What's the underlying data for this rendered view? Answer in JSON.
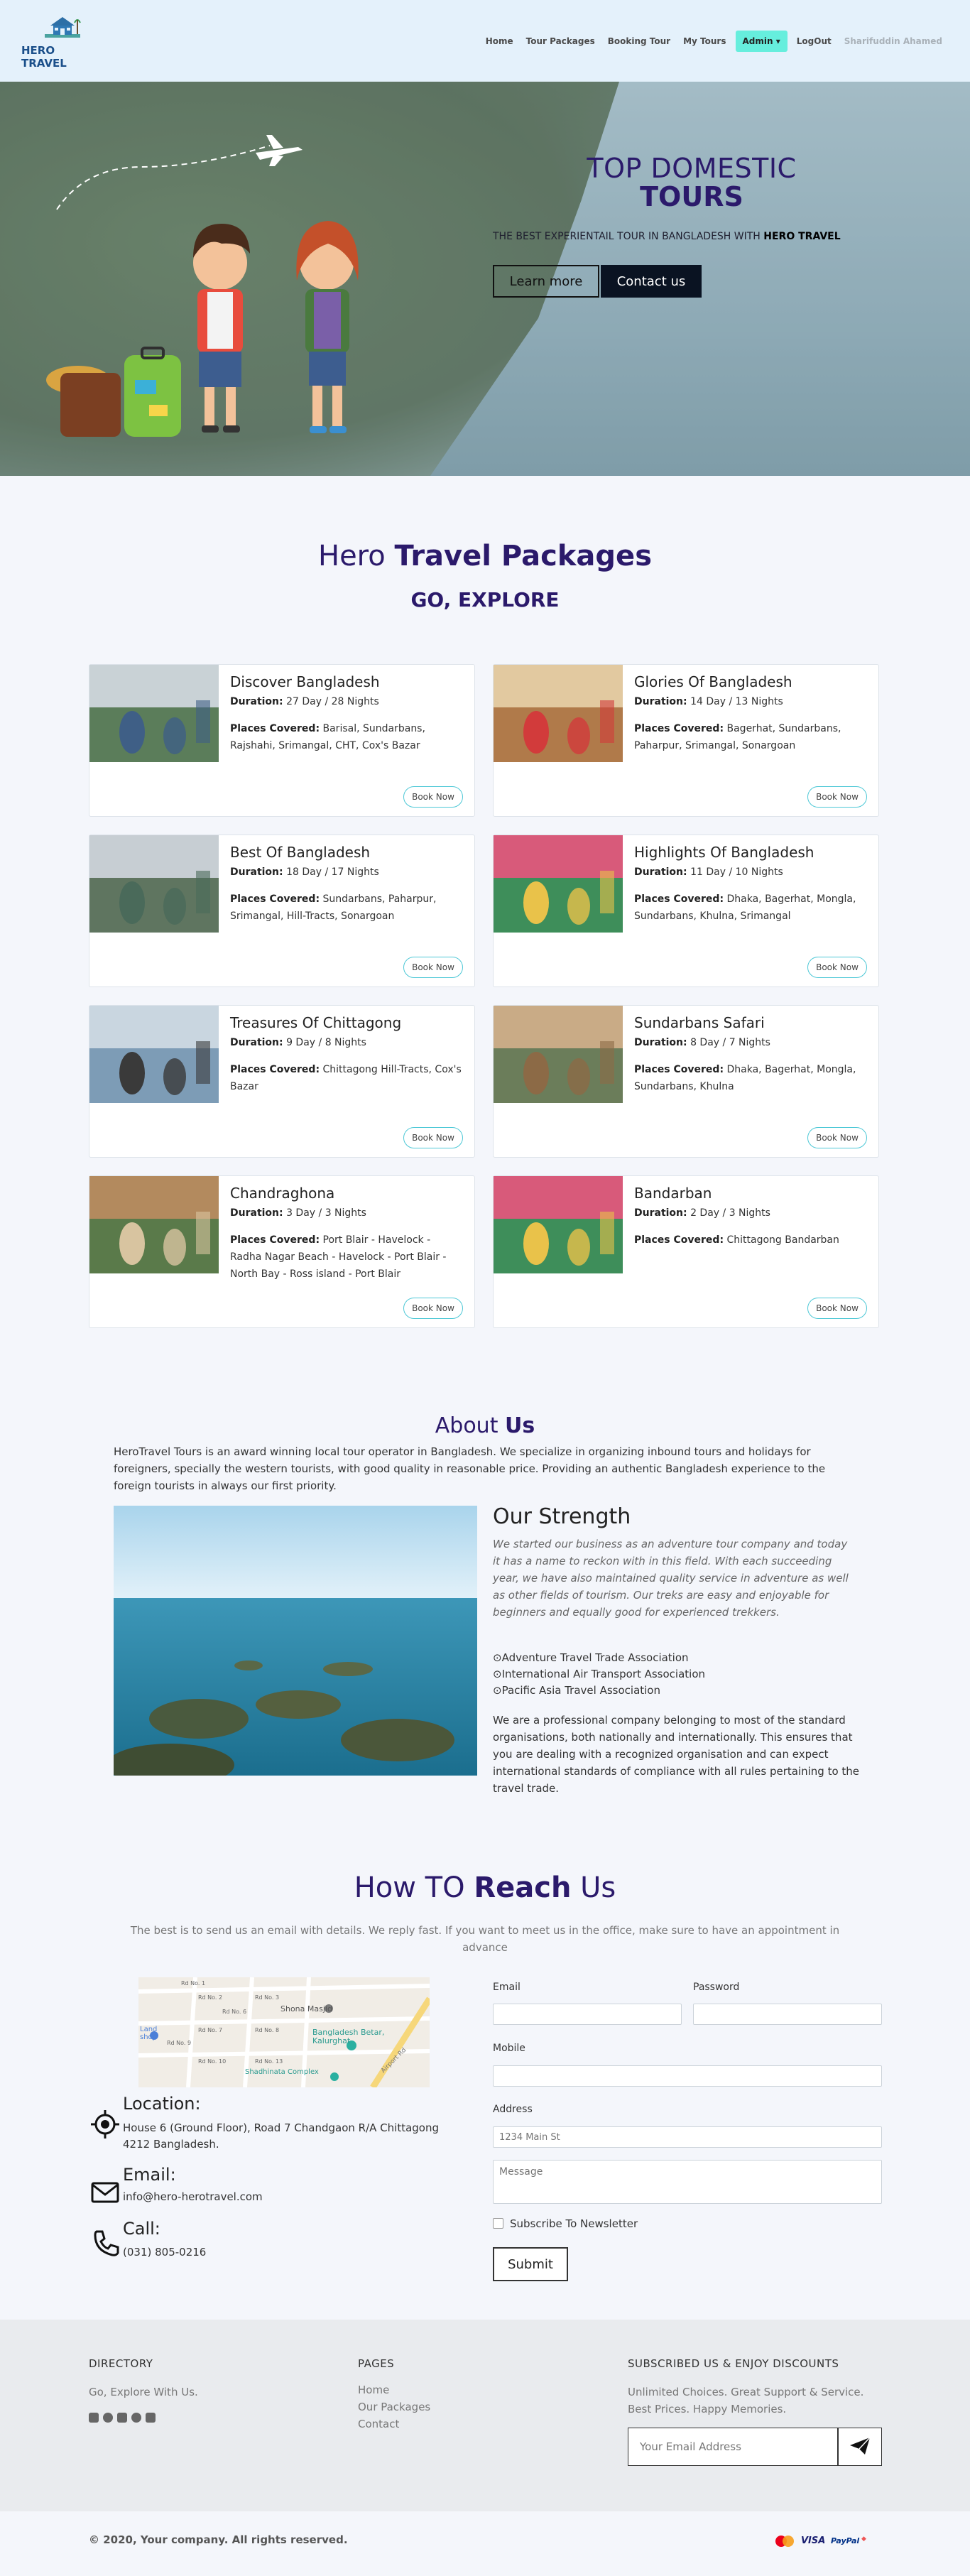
{
  "nav": {
    "brand": "HERO TRAVEL",
    "links": [
      "Home",
      "Tour Packages",
      "Booking Tour",
      "My Tours"
    ],
    "admin": "Admin",
    "logout": "LogOut",
    "user": "Sharifuddin Ahamed"
  },
  "hero": {
    "title_line1": "TOP DOMESTIC",
    "title_line2": "TOURS",
    "subtitle_prefix": "THE BEST EXPERIENTAIL TOUR IN BANGLADESH WITH",
    "subtitle_brand": "HERO TRAVEL",
    "learn_more": "Learn more",
    "contact_us": "Contact us"
  },
  "packages": {
    "title_plain": "Hero",
    "title_bold": "Travel Packages",
    "subtitle": "GO, EXPLORE",
    "duration_label": "Duration:",
    "places_label": "Places Covered:",
    "book_label": "Book Now",
    "items": [
      {
        "title": "Discover Bangladesh",
        "duration": "27 Day / 28 Nights",
        "places": "Barisal, Sundarbans, Rajshahi, Srimangal, CHT, Cox's Bazar"
      },
      {
        "title": "Glories Of Bangladesh",
        "duration": "14 Day / 13 Nights",
        "places": "Bagerhat, Sundarbans, Paharpur, Srimangal, Sonargoan"
      },
      {
        "title": "Best Of Bangladesh",
        "duration": "18 Day / 17 Nights",
        "places": "Sundarbans, Paharpur, Srimangal, Hill-Tracts, Sonargoan"
      },
      {
        "title": "Highlights Of Bangladesh",
        "duration": "11 Day / 10 Nights",
        "places": "Dhaka, Bagerhat, Mongla, Sundarbans, Khulna, Srimangal"
      },
      {
        "title": "Treasures Of Chittagong",
        "duration": "9 Day / 8 Nights",
        "places": "Chittagong Hill-Tracts, Cox's Bazar"
      },
      {
        "title": "Sundarbans Safari",
        "duration": "8 Day / 7 Nights",
        "places": "Dhaka, Bagerhat, Mongla, Sundarbans, Khulna"
      },
      {
        "title": "Chandraghona",
        "duration": "3 Day / 3 Nights",
        "places": "Port Blair - Havelock - Radha Nagar Beach - Havelock - Port Blair - North Bay - Ross island - Port Blair"
      },
      {
        "title": "Bandarban",
        "duration": "2 Day / 3 Nights",
        "places": "Chittagong Bandarban"
      }
    ]
  },
  "about": {
    "title_plain": "About",
    "title_bold": "Us",
    "text": "HeroTravel Tours is an award winning local tour operator in Bangladesh. We specialize in organizing inbound tours and holidays for foreigners, specially the western tourists, with good quality in reasonable price. Providing an authentic Bangladesh experience to the foreign tourists in always our first priority.",
    "strength_title": "Our Strength",
    "strength_italic": "We started our business as an adventure tour company and today it has a name to reckon with in this field. With each succeeding year, we have also maintained quality service in adventure as well as other fields of tourism. Our treks are easy and enjoyable for beginners and equally good for experienced trekkers.",
    "associations": [
      "Adventure Travel Trade Association",
      "International Air Transport Association",
      "Pacific Asia Travel Association"
    ],
    "strength_text": "We are a professional company belonging to most of the standard organisations, both nationally and internationally. This ensures that you are dealing with a recognized organisation and can expect international standards of compliance with all rules pertaining to the travel trade."
  },
  "reach": {
    "title_plain1": "How TO",
    "title_bold": "Reach",
    "title_plain2": "Us",
    "subtitle": "The best is to send us an email with details. We reply fast. If you want to meet us in the office, make sure to have an appointment in advance",
    "map_labels": [
      "Shona Masjid",
      "Bangladesh Betar, Kalurghat",
      "Shadhinata Complex",
      "Land shop",
      "Rd No. 1",
      "Rd No. 2",
      "Rd No. 3",
      "Rd No. 6",
      "Rd No. 7",
      "Rd No. 8",
      "Rd No. 9",
      "Rd No. 10",
      "Rd No. 13",
      "Airport Rd"
    ],
    "location_label": "Location:",
    "location": "House 6 (Ground Floor), Road 7 Chandgaon R/A Chittagong 4212 Bangladesh.",
    "email_label": "Email:",
    "email": "info@hero-herotravel.com",
    "call_label": "Call:",
    "phone": "(031) 805-0216",
    "form": {
      "email_label": "Email",
      "password_label": "Password",
      "mobile_label": "Mobile",
      "address_label": "Address",
      "address_placeholder": "1234 Main St",
      "message_placeholder": "Message",
      "newsletter_label": "Subscribe To Newsletter",
      "submit_label": "Submit"
    }
  },
  "footer": {
    "directory_title": "DIRECTORY",
    "directory_text": "Go, Explore With Us.",
    "pages_title": "PAGES",
    "pages": [
      "Home",
      "Our Packages",
      "Contact"
    ],
    "subscribe_title": "SUBSCRIBED US & ENJOY DISCOUNTS",
    "subscribe_text": "Unlimited Choices. Great Support & Service. Best Prices. Happy Memories.",
    "email_placeholder": "Your Email Address",
    "copyright": "© 2020, Your company. All rights reserved.",
    "payments": [
      "mastercard",
      "VISA",
      "PayPal",
      "discover"
    ]
  }
}
